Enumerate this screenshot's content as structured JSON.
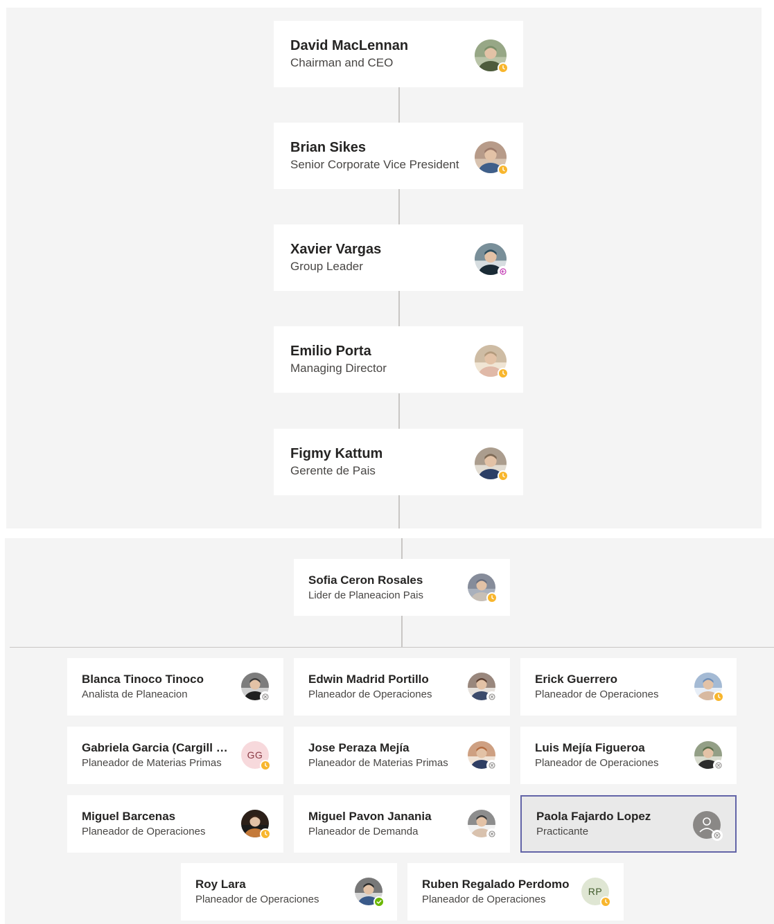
{
  "chain": [
    {
      "name": "David MacLennan",
      "title": "Chairman and CEO",
      "status": "away",
      "palette": [
        "#7b8f6a",
        "#4d5b3c",
        "#b9c4a8"
      ]
    },
    {
      "name": "Brian Sikes",
      "title": "Senior Corporate Vice President",
      "status": "away",
      "palette": [
        "#9c7a6a",
        "#3f5f8a",
        "#d8c3b0"
      ]
    },
    {
      "name": "Xavier Vargas",
      "title": "Group Leader",
      "status": "out-of-office",
      "palette": [
        "#2e4e5e",
        "#1a2b36",
        "#d6dde0"
      ]
    },
    {
      "name": "Emilio Porta",
      "title": "Managing Director",
      "status": "away",
      "palette": [
        "#b39a7c",
        "#e0b9a8",
        "#f0e5d4"
      ]
    },
    {
      "name": "Figmy Kattum",
      "title": "Gerente de Pais",
      "status": "away",
      "palette": [
        "#7e6a56",
        "#2c3f66",
        "#e2dcd2"
      ]
    }
  ],
  "manager": {
    "name": "Sofia Ceron Rosales",
    "title": "Lider de Planeacion Pais",
    "status": "away",
    "palette": [
      "#6a6f7e",
      "#c7bfb6",
      "#a9b0bc"
    ]
  },
  "reports": [
    {
      "name": "Blanca Tinoco Tinoco",
      "title": "Analista de Planeacion",
      "status": "offline",
      "palette": [
        "#3a3a3a",
        "#1f1f1f",
        "#cfcfcf"
      ]
    },
    {
      "name": "Edwin Madrid Portillo",
      "title": "Planeador de Operaciones",
      "status": "offline",
      "palette": [
        "#5a3e30",
        "#3b4a6b",
        "#e6e1dc"
      ]
    },
    {
      "name": "Erick Guerrero",
      "title": "Planeador de Operaciones",
      "status": "away",
      "palette": [
        "#6e8fb8",
        "#d8b9a0",
        "#e7eef7"
      ]
    },
    {
      "name": "Gabriela Garcia (Cargill Meat Solutions)",
      "title": "Planeador de Materias Primas",
      "status": "away",
      "initials": "GG",
      "initials_bg": "#f7d9dc",
      "initials_fg": "#8a3a44"
    },
    {
      "name": "Jose Peraza Mejía",
      "title": "Planeador de Materias Primas",
      "status": "offline",
      "palette": [
        "#b36a3e",
        "#2f3e63",
        "#f0e3d6"
      ]
    },
    {
      "name": "Luis Mejía Figueroa",
      "title": "Planeador de Operaciones",
      "status": "offline",
      "palette": [
        "#5a6e4a",
        "#2c2c2c",
        "#d9dccf"
      ]
    },
    {
      "name": "Miguel Barcenas",
      "title": "Planeador de Operaciones",
      "status": "away",
      "palette": [
        "#3a2418",
        "#c47a3a",
        "#1b1b1b"
      ]
    },
    {
      "name": "Miguel Pavon Janania",
      "title": "Planeador de Demanda",
      "status": "offline",
      "palette": [
        "#3b3b3b",
        "#d9c2ae",
        "#f2f2f2"
      ]
    },
    {
      "name": "Paola Fajardo Lopez",
      "title": "Practicante",
      "status": "offline",
      "placeholder": true
    },
    {
      "name": "Roy Lara",
      "title": "Planeador de Operaciones",
      "status": "available",
      "palette": [
        "#2b2b2b",
        "#3a5a8a",
        "#d6d6d6"
      ]
    },
    {
      "name": "Ruben Regalado Perdomo",
      "title": "Planeador de Operaciones",
      "status": "away",
      "initials": "RP",
      "initials_bg": "#dfe6d3",
      "initials_fg": "#3f5a2a"
    }
  ],
  "colors": {
    "away": "#f8b62d",
    "available": "#6bb700",
    "out-of-office": "#c239b3",
    "offline": "#8a8886",
    "selected_border": "#6264a7"
  }
}
